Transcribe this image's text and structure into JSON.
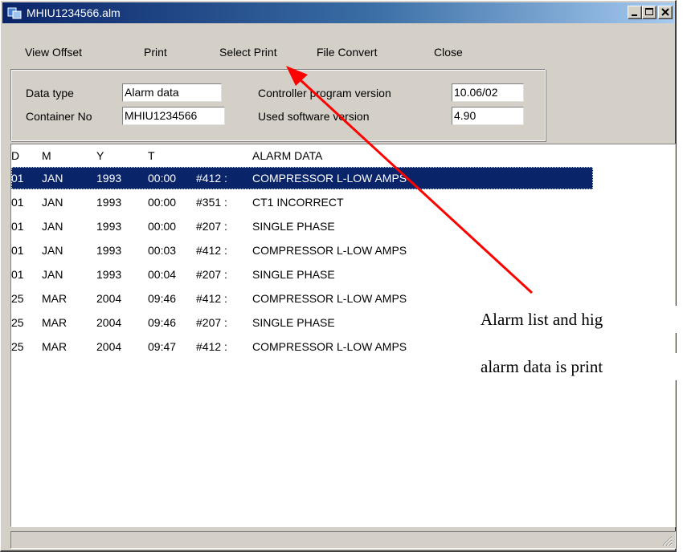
{
  "window": {
    "title": "MHIU1234566.alm",
    "buttons": {
      "minimize_icon": "minimize-icon",
      "maximize_icon": "maximize-icon",
      "close_icon": "close-icon"
    }
  },
  "menu": {
    "items": [
      {
        "label": "View Offset"
      },
      {
        "label": "Print"
      },
      {
        "label": "Select Print"
      },
      {
        "label": "File Convert"
      },
      {
        "label": "Close"
      }
    ]
  },
  "info": {
    "data_type_label": "Data type",
    "data_type_value": "Alarm data",
    "container_label": "Container No",
    "container_value": "MHIU1234566",
    "controller_label": "Controller program version",
    "controller_value": "10.06/02",
    "software_label": "Used software version",
    "software_value": "4.90"
  },
  "list": {
    "headers": {
      "d": "D",
      "m": "M",
      "y": "Y",
      "t": "T",
      "alarm": "ALARM DATA"
    },
    "selected_index": 0,
    "rows": [
      {
        "d": "01",
        "m": "JAN",
        "y": "1993",
        "t": "00:00",
        "code": "#412 :",
        "msg": "COMPRESSOR L-LOW AMPS"
      },
      {
        "d": "01",
        "m": "JAN",
        "y": "1993",
        "t": "00:00",
        "code": "#351 :",
        "msg": "CT1 INCORRECT"
      },
      {
        "d": "01",
        "m": "JAN",
        "y": "1993",
        "t": "00:00",
        "code": "#207 :",
        "msg": "SINGLE PHASE"
      },
      {
        "d": "01",
        "m": "JAN",
        "y": "1993",
        "t": "00:03",
        "code": "#412 :",
        "msg": "COMPRESSOR L-LOW AMPS"
      },
      {
        "d": "01",
        "m": "JAN",
        "y": "1993",
        "t": "00:04",
        "code": "#207 :",
        "msg": "SINGLE PHASE"
      },
      {
        "d": "25",
        "m": "MAR",
        "y": "2004",
        "t": "09:46",
        "code": "#412 :",
        "msg": "COMPRESSOR L-LOW AMPS"
      },
      {
        "d": "25",
        "m": "MAR",
        "y": "2004",
        "t": "09:46",
        "code": "#207 :",
        "msg": "SINGLE PHASE"
      },
      {
        "d": "25",
        "m": "MAR",
        "y": "2004",
        "t": "09:47",
        "code": "#412 :",
        "msg": "COMPRESSOR L-LOW AMPS"
      }
    ]
  },
  "annotation": {
    "line1": "Alarm list and hig",
    "line2": "alarm data is print",
    "arrow_color": "#ff0000"
  },
  "colors": {
    "titlebar_start": "#0a246a",
    "selection": "#0a246a",
    "face": "#d4d0c8"
  }
}
